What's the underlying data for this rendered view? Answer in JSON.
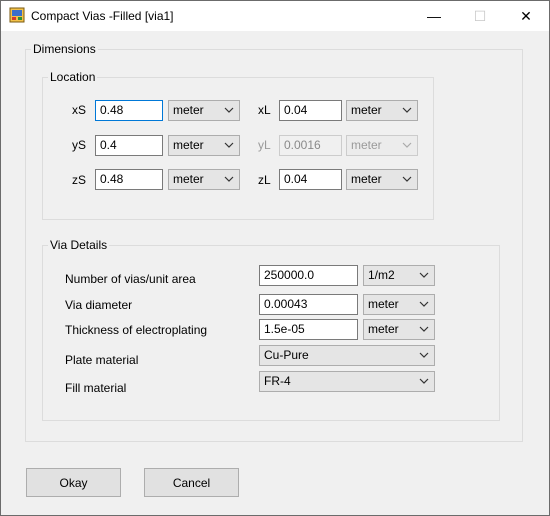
{
  "window": {
    "title": "Compact Vias -Filled [via1]",
    "minimize_glyph": "—",
    "maximize_glyph": "☐",
    "close_glyph": "✕"
  },
  "dimensions": {
    "group_label": "Dimensions",
    "location": {
      "group_label": "Location",
      "xS": {
        "label": "xS",
        "value": "0.48",
        "unit": "meter"
      },
      "yS": {
        "label": "yS",
        "value": "0.4",
        "unit": "meter"
      },
      "zS": {
        "label": "zS",
        "value": "0.48",
        "unit": "meter"
      },
      "xL": {
        "label": "xL",
        "value": "0.04",
        "unit": "meter"
      },
      "yL": {
        "label": "yL",
        "value": "0.0016",
        "unit": "meter",
        "enabled": false
      },
      "zL": {
        "label": "zL",
        "value": "0.04",
        "unit": "meter"
      }
    },
    "via_details": {
      "group_label": "Via Details",
      "num_vias": {
        "label": "Number of vias/unit area",
        "value": "250000.0",
        "unit": "1/m2"
      },
      "via_diameter": {
        "label": "Via diameter",
        "value": "0.00043",
        "unit": "meter"
      },
      "thickness": {
        "label": "Thickness of electroplating",
        "value": "1.5e-05",
        "unit": "meter"
      },
      "plate_material": {
        "label": "Plate material",
        "value": "Cu-Pure"
      },
      "fill_material": {
        "label": "Fill material",
        "value": "FR-4"
      }
    }
  },
  "buttons": {
    "okay": "Okay",
    "cancel": "Cancel"
  },
  "colors": {
    "focus_border": "#0078d7",
    "window_bg": "#f0f0f0"
  }
}
